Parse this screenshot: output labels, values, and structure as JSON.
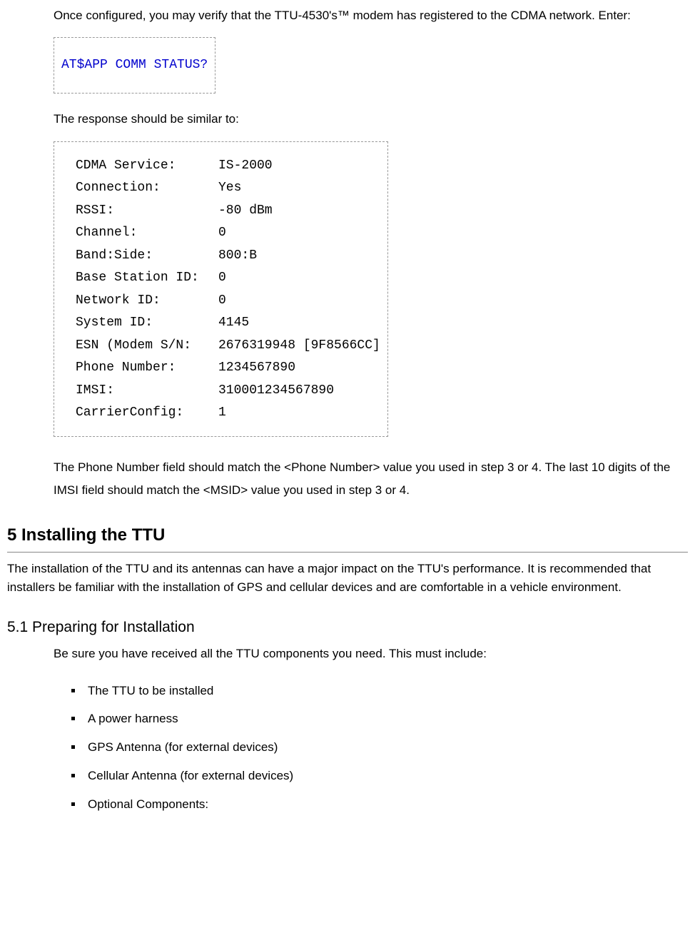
{
  "intro": {
    "line1": "Once configured, you may verify that the TTU-4530's™ modem has registered to the CDMA network. Enter:",
    "command": "AT$APP COMM STATUS?",
    "line2": "The response should be similar to:"
  },
  "status": {
    "rows": [
      {
        "label": "CDMA Service:",
        "value": "IS-2000"
      },
      {
        "label": "Connection:",
        "value": "Yes"
      },
      {
        "label": "RSSI:",
        "value": "-80 dBm"
      },
      {
        "label": "Channel:",
        "value": "0"
      },
      {
        "label": "Band:Side:",
        "value": "800:B"
      },
      {
        "label": "Base Station ID:",
        "value": "0"
      },
      {
        "label": "Network ID:",
        "value": "0"
      },
      {
        "label": "System ID:",
        "value": "4145"
      },
      {
        "label": "ESN (Modem S/N:",
        "value": "2676319948 [9F8566CC]"
      },
      {
        "label": "Phone Number:",
        "value": "1234567890"
      },
      {
        "label": "IMSI:",
        "value": "310001234567890"
      },
      {
        "label": "CarrierConfig:",
        "value": "1"
      }
    ]
  },
  "after": "The Phone Number field should match the <Phone Number> value you used in step 3 or 4. The last 10 digits of the IMSI field should match the <MSID> value you used in step 3 or 4.",
  "sec5": {
    "title": "5 Installing the TTU",
    "body": "The installation of the TTU and its antennas can have a major impact on the TTU's performance. It is recommended that installers be familiar with the installation of GPS and cellular devices and are comfortable in a vehicle environment."
  },
  "sec51": {
    "title": "5.1 Preparing for Installation",
    "lead": "Be sure you have received all the TTU components you need. This must include:",
    "items": [
      "The TTU to be installed",
      "A power harness",
      "GPS Antenna (for external devices)",
      "Cellular Antenna (for external devices)",
      "Optional Components:"
    ]
  }
}
